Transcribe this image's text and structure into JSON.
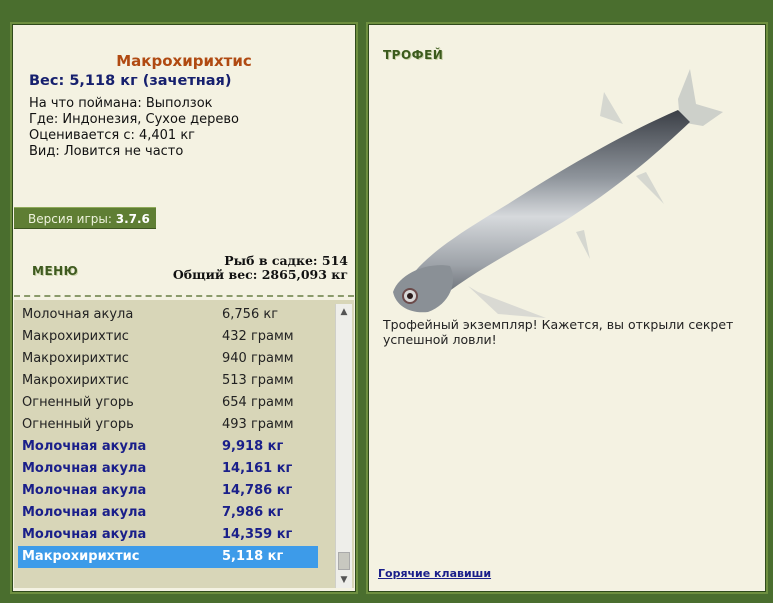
{
  "details": {
    "fish_name": "Макрохирихтис",
    "weight": "Вес: 5,118 кг (зачетная)",
    "caught_on": "На что поймана: Выползок",
    "location": "Где: Индонезия, Сухое дерево",
    "rated_from": "Оценивается с: 4,401 кг",
    "species": "Вид: Ловится не часто"
  },
  "version": {
    "label": "Версия игры:",
    "value": "3.7.6"
  },
  "menu_label": "МЕНЮ",
  "stats": {
    "count": "Рыб в садке: 514",
    "total": "Общий вес: 2865,093 кг"
  },
  "catch_list": [
    {
      "name": "Молочная акула",
      "weight": "6,756 кг"
    },
    {
      "name": "Макрохирихтис",
      "weight": "432 грамм"
    },
    {
      "name": "Макрохирихтис",
      "weight": "940 грамм"
    },
    {
      "name": "Макрохирихтис",
      "weight": "513 грамм"
    },
    {
      "name": "Огненный угорь",
      "weight": "654 грамм"
    },
    {
      "name": "Огненный угорь",
      "weight": "493 грамм"
    },
    {
      "name": "Молочная акула",
      "weight": "9,918 кг"
    },
    {
      "name": "Молочная акула",
      "weight": "14,161 кг"
    },
    {
      "name": "Молочная акула",
      "weight": "14,786 кг"
    },
    {
      "name": "Молочная акула",
      "weight": "7,986 кг"
    },
    {
      "name": "Молочная акула",
      "weight": "14,359 кг"
    },
    {
      "name": "Макрохирихтис",
      "weight": "5,118 кг"
    }
  ],
  "trophy": {
    "title": "ТРОФЕЙ",
    "message": "Трофейный экземпляр! Кажется, вы открыли секрет успешной ловли!",
    "hotkeys": "Горячие клавиши"
  }
}
